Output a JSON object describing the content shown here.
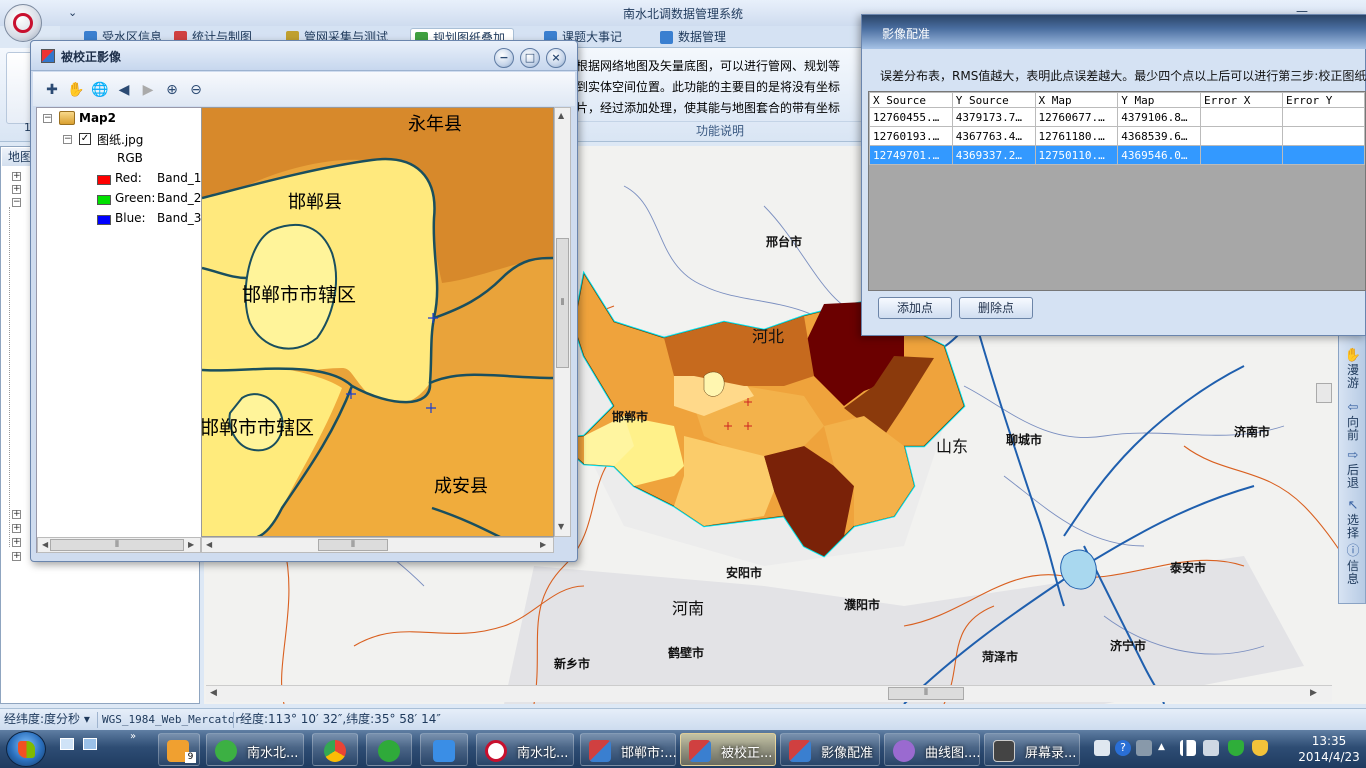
{
  "app": {
    "title": "南水北调数据管理系统",
    "quick_access_chevron": "⌄"
  },
  "window_controls": {
    "minimize": "—"
  },
  "tabs": [
    {
      "label": "受水区信息",
      "icon": "water-icon",
      "color": "#3a7fd0"
    },
    {
      "label": "统计与制图",
      "icon": "chart-icon",
      "color": "#d04040"
    },
    {
      "label": "管网采集与测试",
      "icon": "pipe-icon",
      "color": "#c0a030"
    },
    {
      "label": "规划图纸叠加",
      "icon": "overlay-icon",
      "color": "#40a040"
    },
    {
      "label": "课题大事记",
      "icon": "calendar-icon",
      "color": "#3a7fd0"
    },
    {
      "label": "数据管理",
      "icon": "table-icon",
      "color": "#3a7fd0"
    }
  ],
  "ribbon": {
    "big_button_label": "1",
    "description_lines": [
      "根据网络地图及矢量底图，可以进行管网、规划等",
      "到实体空间位置。此功能的主要目的是将没有坐标",
      "片，经过添加处理，使其能与地图套合的带有坐标"
    ],
    "group_label": "功能说明"
  },
  "left_panel": {
    "header": "地图",
    "tree_expanders_top": [
      "+",
      "+",
      "−"
    ],
    "tree_expanders_bottom": [
      "+",
      "+",
      "+",
      "+"
    ]
  },
  "correction_window": {
    "title": "被校正影像",
    "buttons": {
      "minimize": "−",
      "restore": "□",
      "close": "×"
    },
    "toolbar": [
      {
        "name": "add-point-tool",
        "glyph": "✚"
      },
      {
        "name": "pan-tool",
        "glyph": "✋"
      },
      {
        "name": "full-extent-tool",
        "glyph": "🌐"
      },
      {
        "name": "back-tool",
        "glyph": "◀"
      },
      {
        "name": "forward-tool",
        "glyph": "▶"
      },
      {
        "name": "zoom-in-tool",
        "glyph": "⊕"
      },
      {
        "name": "zoom-out-tool",
        "glyph": "⊖"
      }
    ],
    "toc": {
      "map_name": "Map2",
      "layer_name": "图纸.jpg",
      "checked": "✓",
      "rgb_label": "RGB",
      "bands": [
        {
          "channel": "Red:",
          "band": "Band_1",
          "color": "#ff0000"
        },
        {
          "channel": "Green:",
          "band": "Band_2",
          "color": "#00e000"
        },
        {
          "channel": "Blue:",
          "band": "Band_3",
          "color": "#0000ff"
        }
      ]
    },
    "image_labels": [
      "永年县",
      "邯郸县",
      "邯郸市市辖区",
      "邯郸市市辖区",
      "成安县"
    ],
    "scroll_grip": "⦀"
  },
  "registration_window": {
    "title": "影像配准",
    "info": "误差分布表，RMS值越大，表明此点误差越大。最少四个点以上后可以进行第三步:校正图纸",
    "columns": [
      "X Source",
      "Y Source",
      "X Map",
      "Y Map",
      "Error X",
      "Error Y"
    ],
    "rows": [
      [
        "12760455.…",
        "4379173.7…",
        "12760677.…",
        "4379106.8…",
        "",
        ""
      ],
      [
        "12760193.…",
        "4367763.4…",
        "12761180.…",
        "4368539.6…",
        "",
        ""
      ],
      [
        "12749701.…",
        "4369337.2…",
        "12750110.…",
        "4369546.0…",
        "",
        ""
      ]
    ],
    "selected_row": 2,
    "add_point_button": "添加点",
    "delete_point_button": "删除点"
  },
  "main_map": {
    "labels": {
      "xingtai": "邢台市",
      "hebei": "河北",
      "handan": "邯郸市",
      "shandong": "山东",
      "liaocheng": "聊城市",
      "jinan": "济南市",
      "anyang": "安阳市",
      "henan": "河南",
      "puyang": "濮阳市",
      "taian": "泰安市",
      "hebi": "鹤壁市",
      "xinxiang": "新乡市",
      "heze": "菏泽市",
      "jining": "济宁市"
    },
    "scroll_grip": "⦀"
  },
  "vertical_toolbar": [
    {
      "label": "漫游",
      "icon": "hand-icon",
      "glyph": "✋"
    },
    {
      "label": "向前",
      "icon": "arrow-left-icon",
      "glyph": "⇦"
    },
    {
      "label": "后退",
      "icon": "arrow-right-icon",
      "glyph": "⇨"
    },
    {
      "label": "选择",
      "icon": "select-icon",
      "glyph": "↖"
    },
    {
      "label": "信息",
      "icon": "info-icon",
      "glyph": "ⓘ"
    }
  ],
  "statusbar": {
    "unit": "经纬度:度分秒",
    "dropdown_glyph": "▾",
    "crs": "WGS_1984_Web_Mercator",
    "coords": "经度:113° 10′ 32″,纬度:35° 58′ 14″"
  },
  "taskbar": {
    "items": [
      {
        "label": "",
        "icon": "paint-icon",
        "color": "#f0a030",
        "badge": "9"
      },
      {
        "label": "南水北...",
        "icon": "clover-icon",
        "color": "#3cb043"
      },
      {
        "label": "",
        "icon": "chrome-icon",
        "color": "#e94435"
      },
      {
        "label": "",
        "icon": "refresh-icon",
        "color": "#2faa3a"
      },
      {
        "label": "",
        "icon": "cloud-icon",
        "color": "#3a8ee6"
      },
      {
        "label": "南水北...",
        "icon": "app-logo-icon",
        "color": "#c8102e"
      },
      {
        "label": "邯郸市:...",
        "icon": "window-icon",
        "color": "#d04040"
      },
      {
        "label": "被校正...",
        "icon": "window-icon",
        "color": "#d04040"
      },
      {
        "label": "影像配准",
        "icon": "window-icon",
        "color": "#d04040"
      },
      {
        "label": "曲线图....",
        "icon": "palette-icon",
        "color": "#9a6ad0"
      },
      {
        "label": "屏幕录...",
        "icon": "recorder-icon",
        "color": "#444444"
      }
    ],
    "tray_help": "?",
    "tray_arrow": "▲",
    "time": "13:35",
    "date": "2014/4/23"
  }
}
